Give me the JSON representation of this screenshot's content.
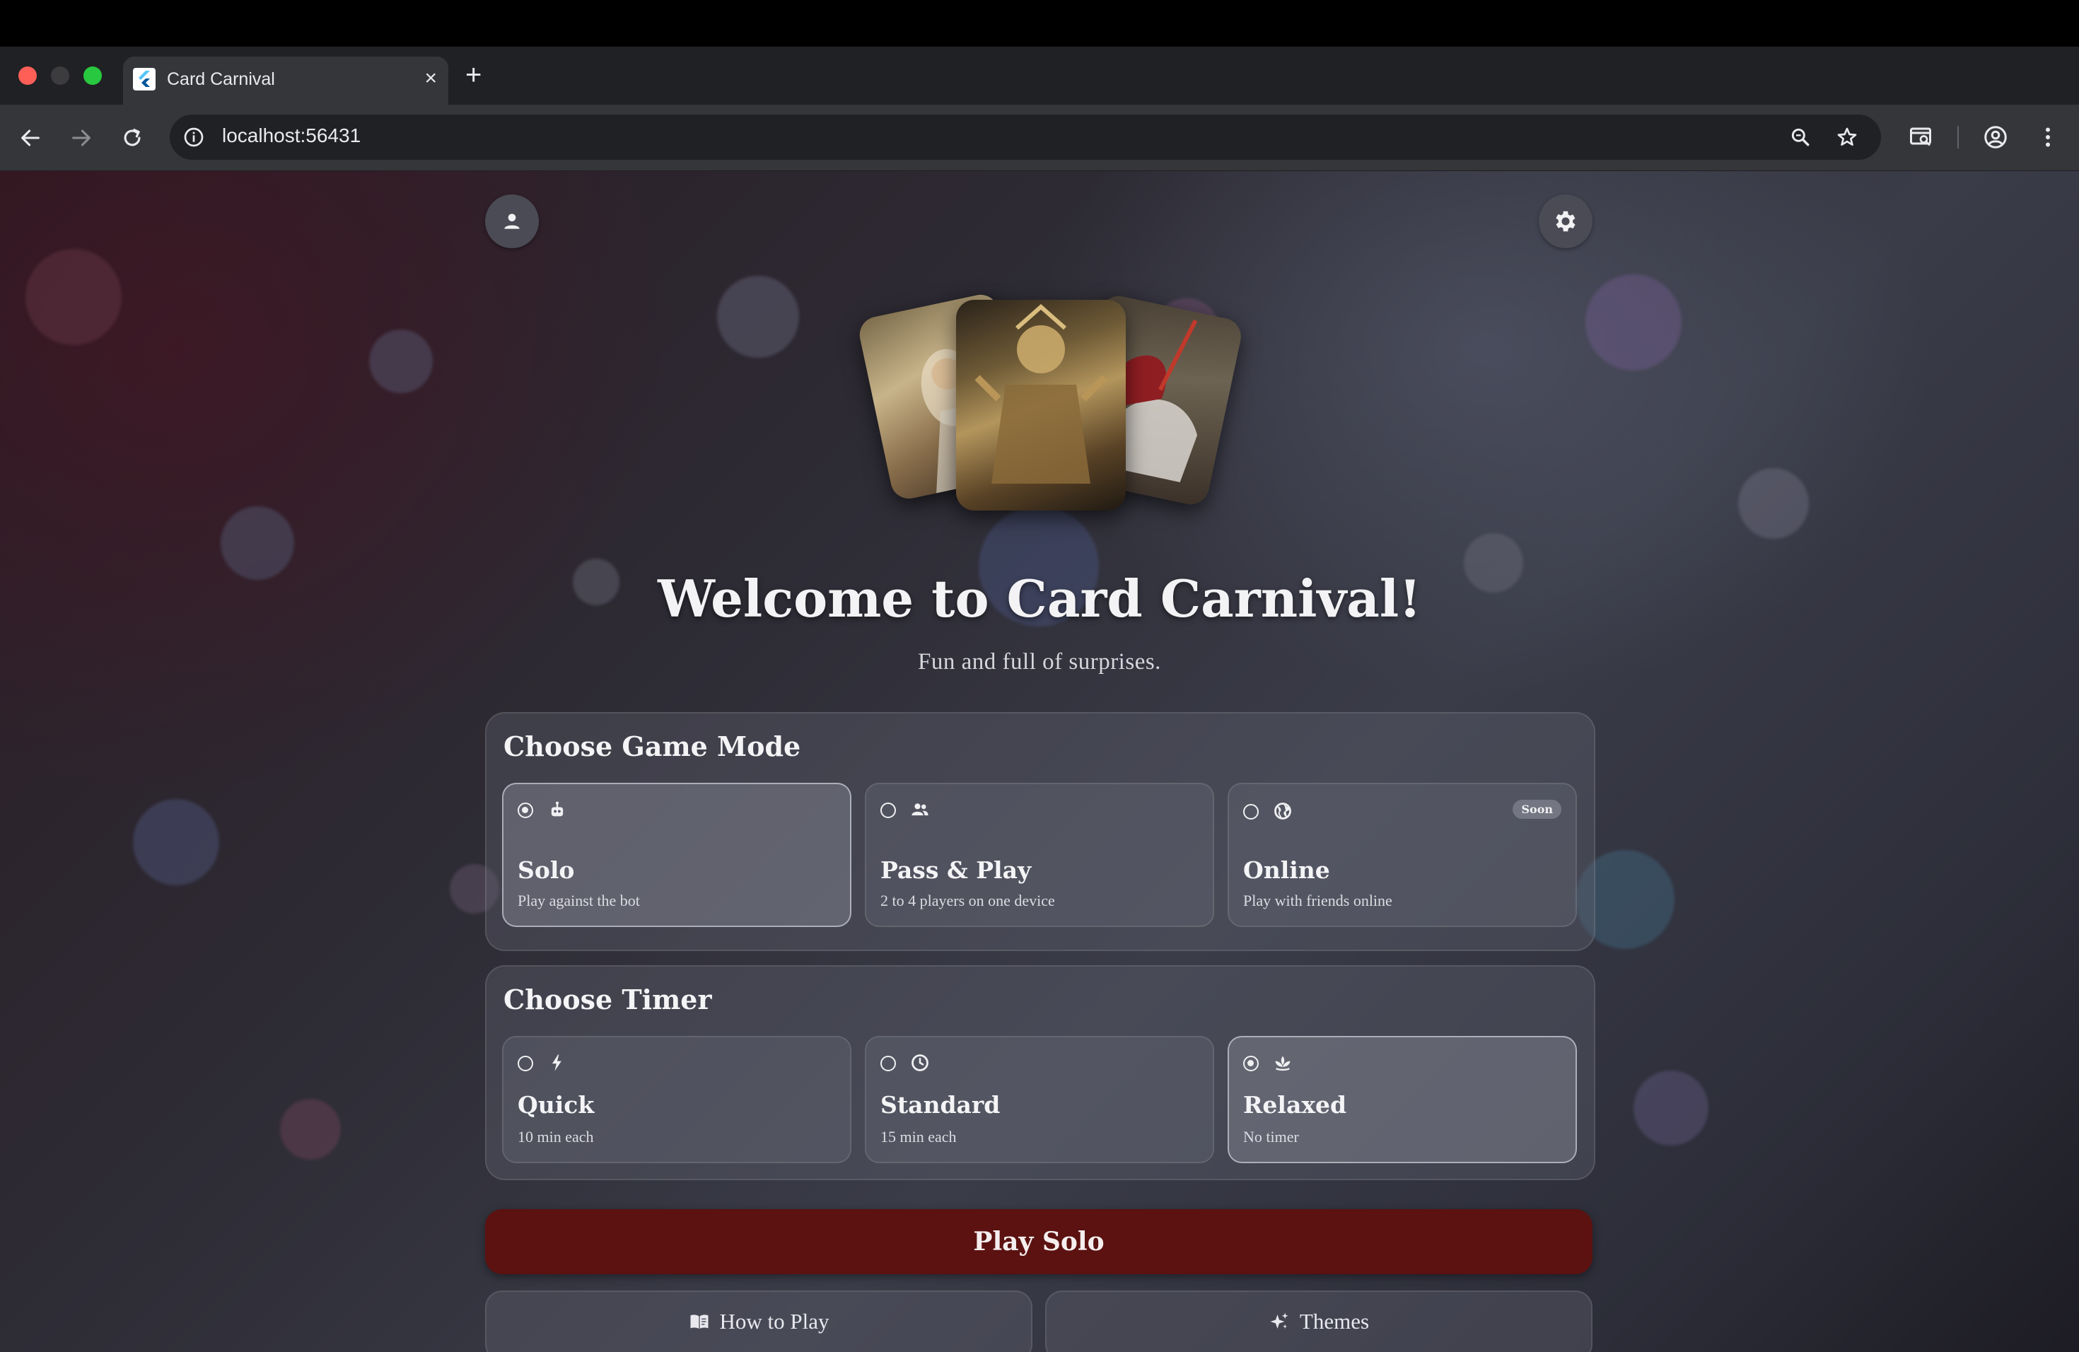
{
  "browser": {
    "tab_title": "Card Carnival",
    "url": "localhost:56431"
  },
  "hero": {
    "title": "Welcome to Card Carnival!",
    "tagline": "Fun and full of surprises."
  },
  "game_mode": {
    "heading": "Choose Game Mode",
    "options": [
      {
        "title": "Solo",
        "subtitle": "Play against the bot",
        "icon": "bot-icon",
        "selected": true
      },
      {
        "title": "Pass & Play",
        "subtitle": "2 to 4 players on one device",
        "icon": "people-icon",
        "selected": false
      },
      {
        "title": "Online",
        "subtitle": "Play with friends online",
        "icon": "globe-icon",
        "selected": false,
        "badge": "Soon"
      }
    ]
  },
  "timer": {
    "heading": "Choose Timer",
    "options": [
      {
        "title": "Quick",
        "subtitle": "10 min each",
        "icon": "bolt-icon",
        "selected": false
      },
      {
        "title": "Standard",
        "subtitle": "15 min each",
        "icon": "clock-icon",
        "selected": false
      },
      {
        "title": "Relaxed",
        "subtitle": "No timer",
        "icon": "lotus-icon",
        "selected": true
      }
    ]
  },
  "actions": {
    "play_label": "Play Solo",
    "how_to_play_label": "How to Play",
    "themes_label": "Themes"
  },
  "colors": {
    "play_button": "#5b1210",
    "background": "#2d2b34"
  }
}
